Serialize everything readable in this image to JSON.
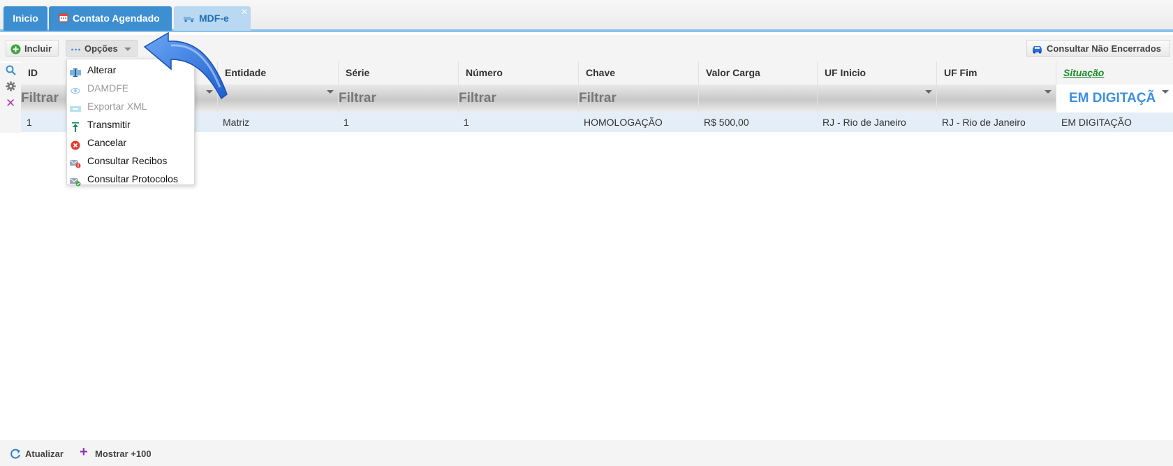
{
  "tabs": [
    {
      "label": "Inicio"
    },
    {
      "label": "Contato Agendado"
    },
    {
      "label": "MDF-e"
    }
  ],
  "toolbar": {
    "incluir_label": "Incluir",
    "opcoes_label": "Opções",
    "consultar_label": "Consultar Não Encerrados"
  },
  "menu": {
    "items": [
      {
        "label": "Alterar",
        "enabled": true,
        "icon": "edit-icon"
      },
      {
        "label": "DAMDFE",
        "enabled": false,
        "icon": "eye-icon"
      },
      {
        "label": "Exportar XML",
        "enabled": false,
        "icon": "xml-icon"
      },
      {
        "label": "Transmitir",
        "enabled": true,
        "icon": "upload-icon"
      },
      {
        "label": "Cancelar",
        "enabled": true,
        "icon": "cancel-icon"
      },
      {
        "label": "Consultar Recibos",
        "enabled": true,
        "icon": "mail-alert-icon"
      },
      {
        "label": "Consultar Protocolos",
        "enabled": true,
        "icon": "mail-check-icon"
      }
    ]
  },
  "grid": {
    "columns": [
      "ID",
      "",
      "Entidade",
      "Série",
      "Número",
      "Chave",
      "Valor Carga",
      "UF Inicio",
      "UF Fim",
      "Situação"
    ],
    "filter_placeholder": "Filtrar",
    "situacao_filter": "EM DIGITAÇÃ",
    "rows": [
      {
        "id": "1",
        "entidade": "Matriz",
        "serie": "1",
        "numero": "1",
        "chave": "HOMOLOGAÇÃO",
        "valor": "R$ 500,00",
        "uf_inicio": "RJ - Rio de Janeiro",
        "uf_fim": "RJ - Rio de Janeiro",
        "situacao": "EM DIGITAÇÃO"
      }
    ]
  },
  "footer": {
    "atualizar_label": "Atualizar",
    "mostrar_label": "Mostrar +100"
  },
  "colors": {
    "tab_active": "#3d8fd1",
    "tab_light": "#b9d8f1",
    "row_highlight": "#e4eef8",
    "sort_green": "#1a8a2a",
    "arrow_blue": "#2b6fd8"
  }
}
